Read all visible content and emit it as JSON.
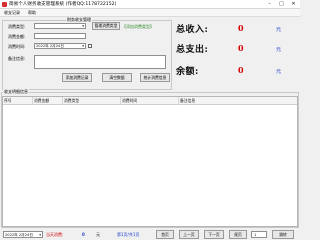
{
  "window": {
    "title": "简易个人财务收支管理系统 (作者QQ:1178722152)",
    "icon": "app-icon"
  },
  "menu": [
    "收支记录",
    "帮助"
  ],
  "entry": {
    "group_title": "财务收支管理",
    "amount_label": "消费金额:",
    "type_label": "消费类型:",
    "time_label": "消费时间:",
    "note_label": "备注信息:",
    "date_value": "2022年 2月24日",
    "manage_types_label": "管理消费类型",
    "add_type_link": "【添加消费类型】",
    "add_record_label": "添加消费记录",
    "clear_label": "清空数据",
    "stats_label": "统计消费信息"
  },
  "summary": {
    "income_label": "总收入:",
    "income_value": "0",
    "expense_label": "总支出:",
    "expense_value": "0",
    "balance_label": "余额:",
    "balance_value": "0",
    "unit": "元"
  },
  "details": {
    "title": "收支明细信息",
    "columns": [
      "序号",
      "消费金额",
      "消费类型",
      "消费时间",
      "备注信息"
    ]
  },
  "footer": {
    "date_value": "2022年 2月24日",
    "today_label": "当天消费:",
    "today_value": "0",
    "unit": "元",
    "page_info": "第1页/共1页",
    "first_label": "首页",
    "prev_label": "上一页",
    "next_label": "下一页",
    "last_label": "尾页",
    "page_value": "1",
    "jump_label": "跳转"
  },
  "colors": {
    "accent_red": "#d60000",
    "unit_blue": "#1a3cc8",
    "link_green": "#2a8a2a"
  }
}
